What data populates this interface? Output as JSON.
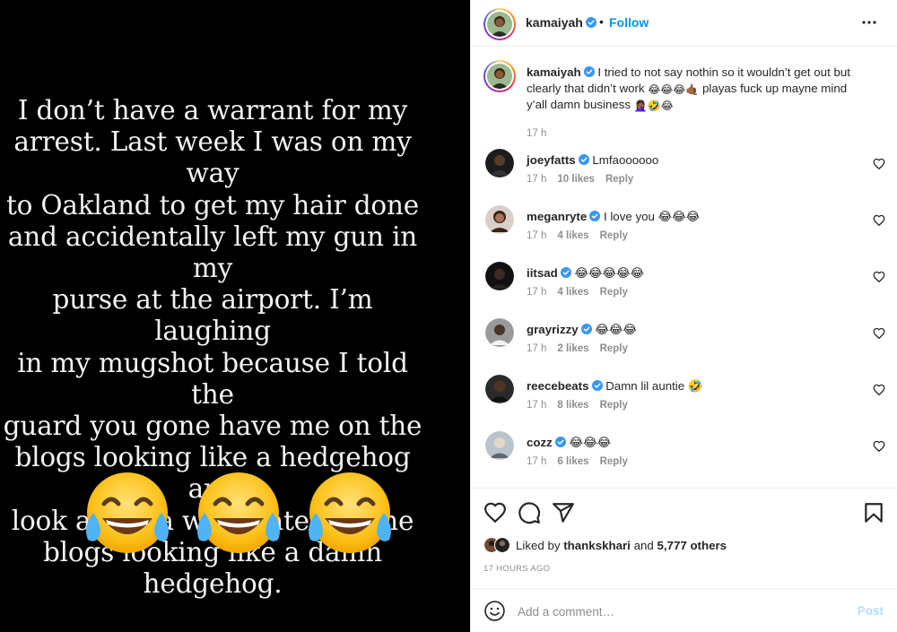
{
  "media": {
    "lines": [
      "I don’t have a warrant for my",
      "arrest. Last week I was on my way",
      "to Oakland to get my hair done",
      "and  accidentally left my gun in my",
      "purse at the airport. I’m laughing",
      "in my mugshot because I told the",
      "guard you gone have me on the",
      "blogs looking like a hedgehog and",
      "look at me a week later on the",
      "blogs looking like a damn",
      "hedgehog."
    ],
    "emoji_icon": "face-with-tears-of-joy-icon"
  },
  "header": {
    "username": "kamaiyah",
    "separator": "•",
    "follow_label": "Follow"
  },
  "caption": {
    "username": "kamaiyah",
    "text_line1": "I tried to not say nothin so it wouldn’t get out but",
    "text_line2a": "clearly that didn’t work",
    "text_line2_emojis": "😂😂😂🤙🏾",
    "text_line2b": "playas fuck up mayne mind",
    "text_line3": "y’all damn business",
    "text_line3_emojis": "🤦🏾‍♀️🤣😂",
    "time": "17 h"
  },
  "comments": [
    {
      "username": "joeyfatts",
      "text": "Lmfaoooooo",
      "time": "17 h",
      "likes": "10 likes",
      "reply": "Reply"
    },
    {
      "username": "meganryte",
      "text": "I love you 😂😂😂",
      "time": "17 h",
      "likes": "4 likes",
      "reply": "Reply"
    },
    {
      "username": "iitsad",
      "text": "😂😂😂😂😂",
      "time": "17 h",
      "likes": "4 likes",
      "reply": "Reply"
    },
    {
      "username": "grayrizzy",
      "text": "😂😂😂",
      "time": "17 h",
      "likes": "2 likes",
      "reply": "Reply"
    },
    {
      "username": "reecebeats",
      "text": "Damn lil auntie 🤣",
      "time": "17 h",
      "likes": "8 likes",
      "reply": "Reply"
    },
    {
      "username": "cozz",
      "text": "😂😂😂",
      "time": "17 h",
      "likes": "6 likes",
      "reply": "Reply"
    }
  ],
  "likes_summary": {
    "prefix": "Liked by",
    "user": "thankskhari",
    "conjunction": "and",
    "others": "5,777 others"
  },
  "timestamp": "17 HOURS AGO",
  "add_comment": {
    "placeholder": "Add a comment…",
    "post_label": "Post"
  },
  "colors": {
    "link_blue": "#0095f6",
    "post_disabled": "#b2dffc",
    "muted": "#8e8e8e",
    "verified": "#3897f0"
  }
}
